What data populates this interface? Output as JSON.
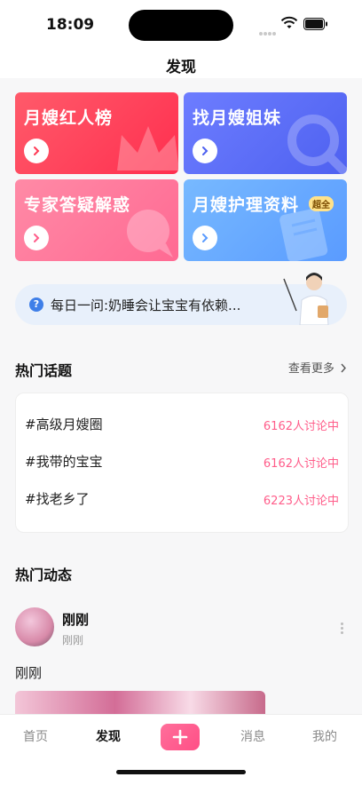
{
  "status_bar": {
    "time": "18:09"
  },
  "nav": {
    "title": "发现"
  },
  "cards": [
    {
      "title": "月嫂红人榜"
    },
    {
      "title": "找月嫂姐妹"
    },
    {
      "title": "专家答疑解惑"
    },
    {
      "title": "月嫂护理资料",
      "badge": "超全"
    }
  ],
  "daily_question": {
    "text": "每日一问:奶睡会让宝宝有依赖..."
  },
  "hot_topics": {
    "title": "热门话题",
    "see_more": "查看更多",
    "items": [
      {
        "name": "#高级月嫂圈",
        "count": "6162人讨论中"
      },
      {
        "name": "#我带的宝宝",
        "count": "6162人讨论中"
      },
      {
        "name": "#找老乡了",
        "count": "6223人讨论中"
      }
    ]
  },
  "hot_posts": {
    "title": "热门动态",
    "post": {
      "user": "刚刚",
      "time": "刚刚",
      "text": "刚刚"
    }
  },
  "tabbar": {
    "items": [
      {
        "label": "首页"
      },
      {
        "label": "发现"
      },
      {
        "label": "消息"
      },
      {
        "label": "我的"
      }
    ],
    "active": "发现"
  },
  "colors": {
    "accent_pink": "#ff5d8a",
    "card_red": "#ff2f4f",
    "card_blue": "#4e61f0",
    "card_pink": "#ff6a93",
    "card_sky": "#5a9bff"
  }
}
